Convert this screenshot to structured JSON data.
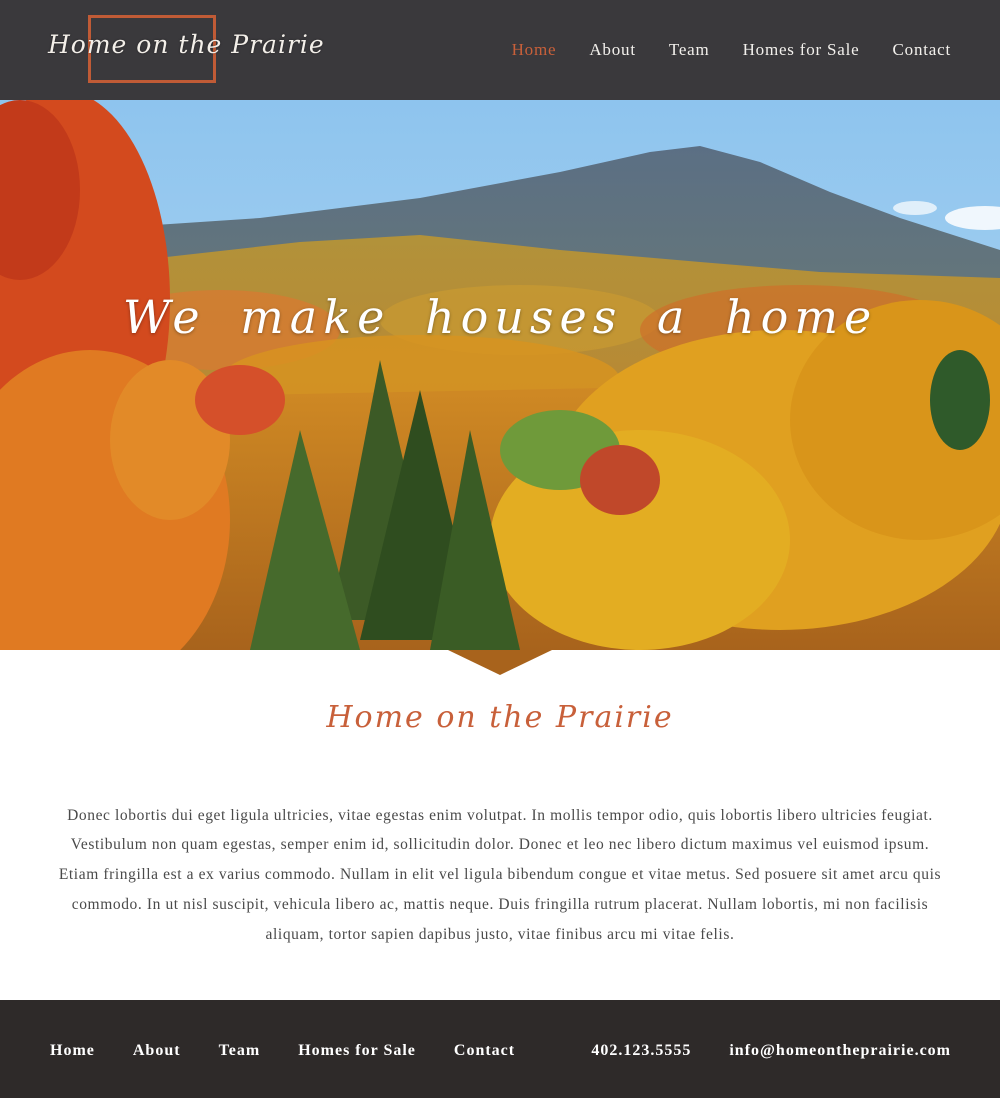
{
  "header": {
    "logo_text": "Home on the Prairie",
    "nav": [
      {
        "label": "Home",
        "active": true
      },
      {
        "label": "About",
        "active": false
      },
      {
        "label": "Team",
        "active": false
      },
      {
        "label": "Homes for Sale",
        "active": false
      },
      {
        "label": "Contact",
        "active": false
      }
    ]
  },
  "hero": {
    "tagline": "We make houses a home",
    "image": "autumn-mountain-forest"
  },
  "intro": {
    "title": "Home on the Prairie",
    "body": "Donec lobortis dui eget ligula ultricies, vitae egestas enim volutpat. In mollis tempor odio, quis lobortis libero ultricies feugiat. Vestibulum non quam egestas, semper enim id, sollicitudin dolor. Donec et leo nec libero dictum maximus vel euismod ipsum. Etiam fringilla est a ex varius commodo. Nullam in elit vel ligula bibendum congue et vitae metus. Sed posuere sit amet arcu quis commodo. In ut nisl suscipit, vehicula libero ac, mattis neque. Duis fringilla rutrum placerat. Nullam lobortis, mi non facilisis aliquam, tortor sapien dapibus justo, vitae finibus arcu mi vitae felis."
  },
  "footer": {
    "nav": [
      "Home",
      "About",
      "Team",
      "Homes for Sale",
      "Contact"
    ],
    "phone": "402.123.5555",
    "email": "info@homeontheprairie.com"
  },
  "colors": {
    "header_bg": "#3a393c",
    "accent": "#c8603a",
    "footer_bg": "#2e2a29",
    "body_text": "#4a4a4a"
  }
}
